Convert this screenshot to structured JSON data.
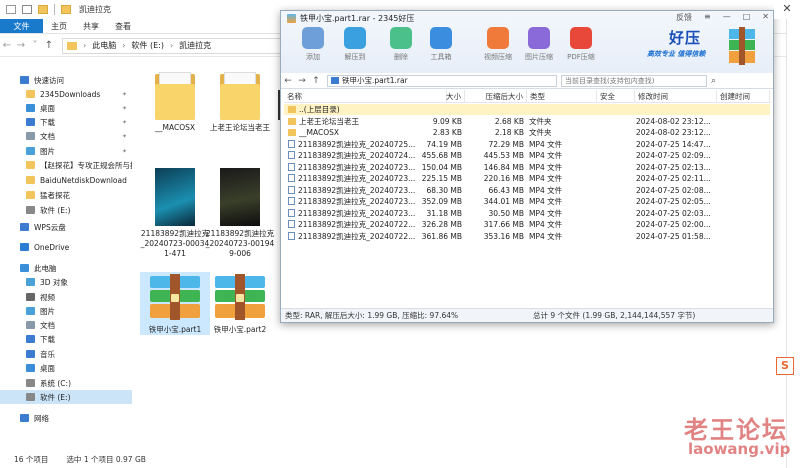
{
  "explorer": {
    "title": "凯迪拉克",
    "tabs": [
      "文件",
      "主页",
      "共享",
      "查看"
    ],
    "breadcrumbs": [
      "此电脑",
      "软件 (E:)",
      "凯迪拉克"
    ],
    "sidebar": [
      {
        "label": "快速访问",
        "icon": "star-icon",
        "color": "#3b7bd0"
      },
      {
        "label": "2345Downloads",
        "icon": "folder-icon",
        "color": "#f2c55c"
      },
      {
        "label": "桌面",
        "icon": "desktop-icon",
        "color": "#3b8fd8"
      },
      {
        "label": "下载",
        "icon": "download-icon",
        "color": "#3b7bd0"
      },
      {
        "label": "文档",
        "icon": "document-icon",
        "color": "#8899aa"
      },
      {
        "label": "图片",
        "icon": "picture-icon",
        "color": "#4aa0d8"
      },
      {
        "label": "【赵探花】专攻正规会所与按",
        "icon": "folder-icon",
        "color": "#f2c55c"
      },
      {
        "label": "BaiduNetdiskDownload",
        "icon": "folder-icon",
        "color": "#f2c55c"
      },
      {
        "label": "猛者探花",
        "icon": "folder-icon",
        "color": "#f2c55c"
      },
      {
        "label": "软件 (E:)",
        "icon": "drive-icon",
        "color": "#888888"
      },
      {
        "label": "WPS云盘",
        "icon": "cloud-icon",
        "color": "#3b7bd0"
      },
      {
        "label": "OneDrive",
        "icon": "cloud-icon",
        "color": "#2b7cd3"
      },
      {
        "label": "此电脑",
        "icon": "computer-icon",
        "color": "#3b8fd8"
      },
      {
        "label": "3D 对象",
        "icon": "cube-icon",
        "color": "#4aa0d8"
      },
      {
        "label": "视频",
        "icon": "video-icon",
        "color": "#666666"
      },
      {
        "label": "图片",
        "icon": "picture-icon",
        "color": "#4aa0d8"
      },
      {
        "label": "文档",
        "icon": "document-icon",
        "color": "#8899aa"
      },
      {
        "label": "下载",
        "icon": "download-icon",
        "color": "#3b7bd0"
      },
      {
        "label": "音乐",
        "icon": "music-icon",
        "color": "#3b7bd0"
      },
      {
        "label": "桌面",
        "icon": "desktop-icon",
        "color": "#3b8fd8"
      },
      {
        "label": "系统 (C:)",
        "icon": "drive-icon",
        "color": "#888888"
      },
      {
        "label": "软件 (E:)",
        "icon": "drive-icon",
        "color": "#888888"
      },
      {
        "label": "网络",
        "icon": "network-icon",
        "color": "#3b7bd0"
      }
    ],
    "files": [
      {
        "name": "__MACOSX",
        "kind": "folder"
      },
      {
        "name": "上老王论坛当老王",
        "kind": "folder"
      },
      {
        "name": "21183892凯迪拉克_20240723-000341-471",
        "kind": "video-blue"
      },
      {
        "name": "21183892凯迪拉克_20240723-001949-006",
        "kind": "video-dark"
      },
      {
        "name": "铁甲小宝.part1",
        "kind": "rar"
      },
      {
        "name": "铁甲小宝.part2",
        "kind": "rar"
      }
    ],
    "status": {
      "count": "16 个项目",
      "selected": "选中 1 个项目 0.97 GB"
    }
  },
  "rar": {
    "title": "铁甲小宝.part1.rar - 2345好压",
    "controls": [
      "反馈",
      "≡",
      "—",
      "□",
      "✕"
    ],
    "tools": [
      {
        "label": "添加",
        "color": "#6f9fd8"
      },
      {
        "label": "解压到",
        "color": "#3aa0e0"
      },
      {
        "label": "删除",
        "color": "#4cc08a"
      },
      {
        "label": "工具箱",
        "color": "#3b8de0"
      },
      {
        "label": "视频压缩",
        "color": "#f07a3a"
      },
      {
        "label": "图片压缩",
        "color": "#8a6ad8"
      },
      {
        "label": "PDF压缩",
        "color": "#e8483a"
      }
    ],
    "brand": {
      "name": "好压",
      "slogan": "高效专业 值得信赖"
    },
    "path": "铁甲小宝.part1.rar",
    "search_placeholder": "当前目录查找(支持包内查找)",
    "columns": [
      "名称",
      "大小",
      "压缩后大小",
      "类型",
      "安全",
      "修改时间",
      "创建时间"
    ],
    "rows": [
      {
        "name": "..(上层目录)",
        "size": "",
        "packed": "",
        "type": "",
        "modified": "",
        "kind": "fold",
        "selected": true
      },
      {
        "name": "上老王论坛当老王",
        "size": "9.09 KB",
        "packed": "2.68 KB",
        "type": "文件夹",
        "modified": "2024-08-02 23:12...",
        "kind": "fold"
      },
      {
        "name": "__MACOSX",
        "size": "2.83 KB",
        "packed": "2.18 KB",
        "type": "文件夹",
        "modified": "2024-08-02 23:12...",
        "kind": "fold"
      },
      {
        "name": "21183892凯迪拉克_20240725...",
        "size": "74.19 MB",
        "packed": "72.29 MB",
        "type": "MP4 文件",
        "modified": "2024-07-25 14:47...",
        "kind": "file"
      },
      {
        "name": "21183892凯迪拉克_20240724...",
        "size": "455.68 MB",
        "packed": "445.53 MB",
        "type": "MP4 文件",
        "modified": "2024-07-25 02:09...",
        "kind": "file"
      },
      {
        "name": "21183892凯迪拉克_20240723...",
        "size": "150.04 MB",
        "packed": "146.84 MB",
        "type": "MP4 文件",
        "modified": "2024-07-25 02:13...",
        "kind": "file"
      },
      {
        "name": "21183892凯迪拉克_20240723...",
        "size": "225.15 MB",
        "packed": "220.16 MB",
        "type": "MP4 文件",
        "modified": "2024-07-25 02:11...",
        "kind": "file"
      },
      {
        "name": "21183892凯迪拉克_20240723...",
        "size": "68.30 MB",
        "packed": "66.43 MB",
        "type": "MP4 文件",
        "modified": "2024-07-25 02:08...",
        "kind": "file"
      },
      {
        "name": "21183892凯迪拉克_20240723...",
        "size": "352.09 MB",
        "packed": "344.01 MB",
        "type": "MP4 文件",
        "modified": "2024-07-25 02:05...",
        "kind": "file"
      },
      {
        "name": "21183892凯迪拉克_20240723...",
        "size": "31.18 MB",
        "packed": "30.50 MB",
        "type": "MP4 文件",
        "modified": "2024-07-25 02:03...",
        "kind": "file"
      },
      {
        "name": "21183892凯迪拉克_20240722...",
        "size": "326.28 MB",
        "packed": "317.66 MB",
        "type": "MP4 文件",
        "modified": "2024-07-25 02:00...",
        "kind": "file"
      },
      {
        "name": "21183892凯迪拉克_20240722...",
        "size": "361.86 MB",
        "packed": "353.16 MB",
        "type": "MP4 文件",
        "modified": "2024-07-25 01:58...",
        "kind": "file"
      }
    ],
    "status_left": "类型: RAR, 解压后大小: 1.99 GB, 压缩比: 97.64%",
    "status_right": "总计 9 个文件 (1.99 GB, 2,144,144,557 字节)"
  },
  "overlay": {
    "close": "✕",
    "side_badge": "S",
    "watermark_cn": "老王论坛",
    "watermark_en": "laowang.vip"
  }
}
